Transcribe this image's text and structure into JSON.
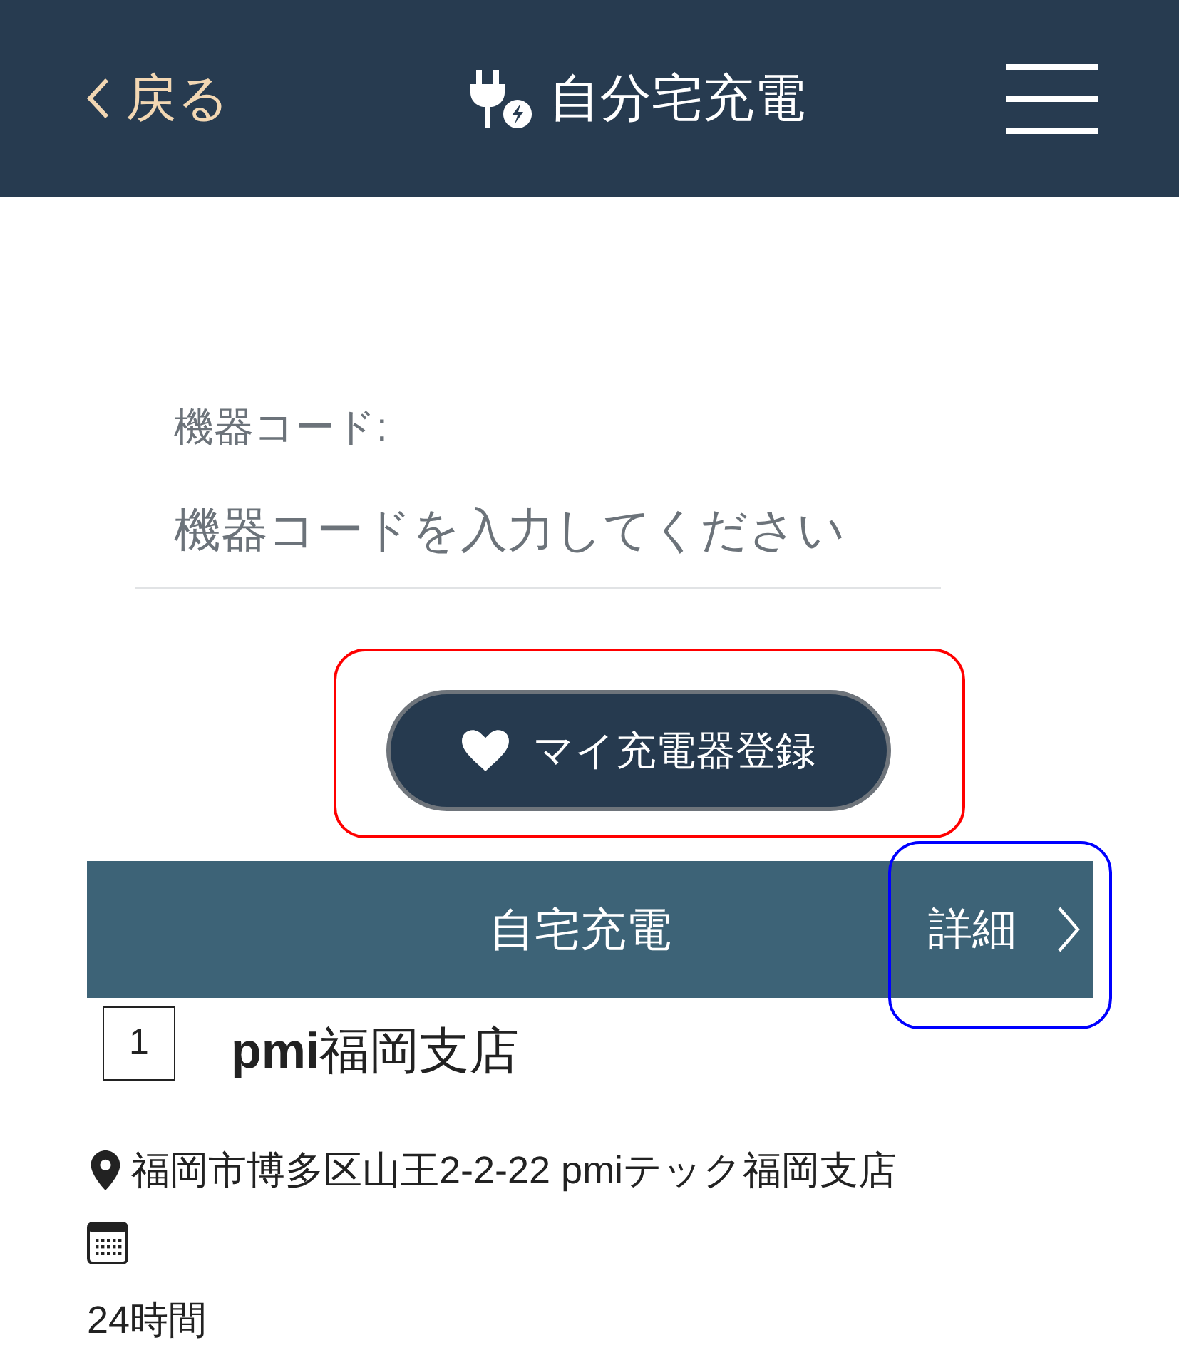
{
  "header": {
    "back_label": "戻る",
    "title": "自分宅充電"
  },
  "device_code": {
    "label": "機器コード:",
    "placeholder": "機器コードを入力してください"
  },
  "register_button": {
    "label": "マイ充電器登録",
    "annotation": {
      "color": "#ff0000"
    }
  },
  "section_bar": {
    "title": "自宅充電",
    "detail": {
      "label": "詳細",
      "annotation": {
        "color": "#0000ff"
      }
    }
  },
  "stations": [
    {
      "number": "1",
      "name": "**pmi**福岡支店",
      "address": "福岡市博多区山王2-2-22 pmiテック福岡支店",
      "hours": "24時間"
    }
  ]
}
